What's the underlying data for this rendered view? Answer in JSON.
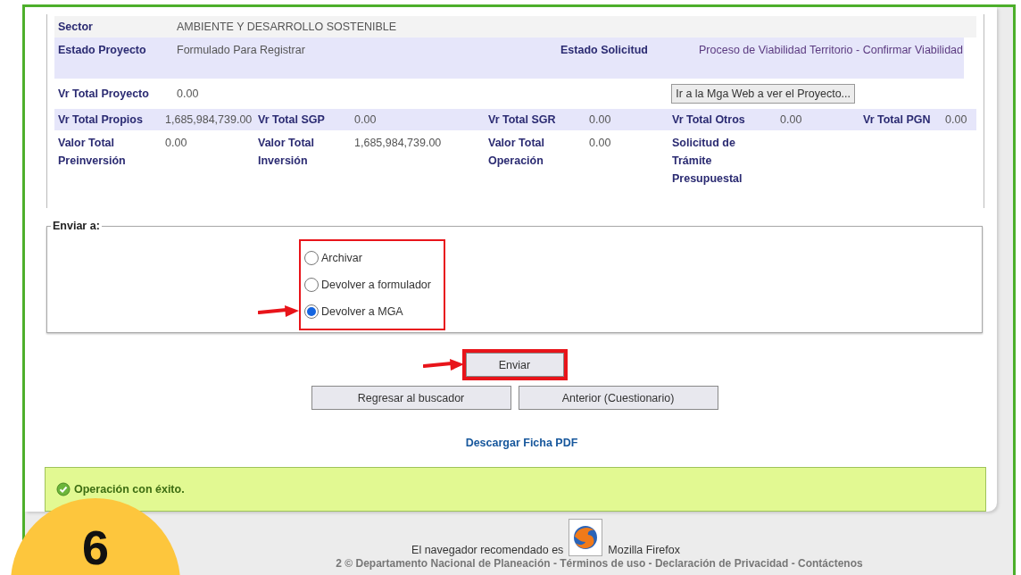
{
  "project": {
    "sector": {
      "label": "Sector",
      "value": "AMBIENTE Y DESARROLLO SOSTENIBLE"
    },
    "status": [
      {
        "label": "Estado Proyecto",
        "value": "Formulado Para Registrar"
      },
      {
        "label": "Estado Solicitud",
        "value": "Proceso de Viabilidad Territorio - Confirmar Viabilidad"
      }
    ],
    "total_project": {
      "label": "Vr Total Proyecto",
      "value": "0.00"
    },
    "mga_button": "Ir a la Mga Web a ver el Proyecto...",
    "totals": [
      {
        "label": "Vr Total Propios",
        "value": "1,685,984,739.00"
      },
      {
        "label": "Vr Total SGP",
        "value": "0.00"
      },
      {
        "label": "Vr Total SGR",
        "value": "0.00"
      },
      {
        "label": "Vr Total Otros",
        "value": "0.00"
      },
      {
        "label": "Vr Total PGN",
        "value": "0.00"
      }
    ],
    "values": [
      {
        "label": "Valor Total Preinversión",
        "value": "0.00"
      },
      {
        "label": "Valor Total Inversión",
        "value": "1,685,984,739.00"
      },
      {
        "label": "Valor Total Operación",
        "value": "0.00"
      },
      {
        "label": "Solicitud de Trámite Presupuestal"
      }
    ]
  },
  "send_to": {
    "legend": "Enviar a:",
    "highlighted": true,
    "options": [
      {
        "label": "Archivar",
        "selected": false,
        "arrow": false
      },
      {
        "label": "Devolver a formulador",
        "selected": false,
        "arrow": false
      },
      {
        "label": "Devolver a MGA",
        "selected": true,
        "arrow": true
      }
    ]
  },
  "send_button": {
    "label": "Enviar",
    "highlighted": true,
    "arrow": true
  },
  "nav_buttons": [
    "Regresar al buscador",
    "Anterior (Cuestionario)"
  ],
  "pdf_link": "Descargar Ficha PDF",
  "success_message": "Operación con éxito.",
  "footer": {
    "browser_text": "El navegador recomendado es",
    "browser_name": "Mozilla Firefox",
    "copyright": "2 © Departamento Nacional de Planeación - Términos de uso - Declaración de Privacidad - Contáctenos"
  },
  "step_badge": "6"
}
